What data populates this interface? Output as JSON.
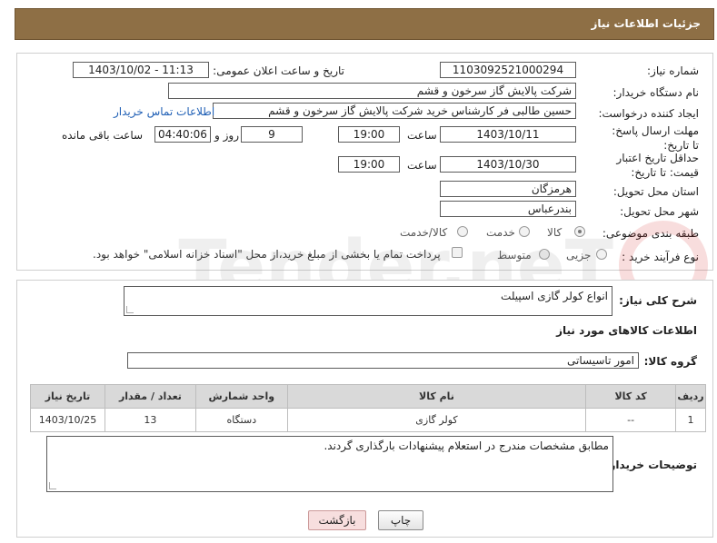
{
  "header": {
    "title": "جزئیات اطلاعات نیاز"
  },
  "form": {
    "need_number_label": "شماره نیاز:",
    "need_number": "1103092521000294",
    "announce_label": "تاریخ و ساعت اعلان عمومی:",
    "announce_value": "1403/10/02 - 11:13",
    "buyer_org_label": "نام دستگاه خریدار:",
    "buyer_org": "شرکت پالایش گاز سرخون و قشم",
    "requester_label": "ایجاد کننده درخواست:",
    "requester": "حسین طالبی فر کارشناس خرید شرکت پالایش گاز سرخون و قشم",
    "contact_link": "اطلاعات تماس خریدار",
    "reply_deadline_label": "مهلت ارسال پاسخ: تا تاریخ:",
    "reply_date": "1403/10/11",
    "time_label": "ساعت",
    "reply_time": "19:00",
    "days_value": "9",
    "days_label": "روز و",
    "remaining_time": "04:40:06",
    "remaining_label": "ساعت باقی مانده",
    "price_validity_label": "حداقل تاریخ اعتبار قیمت: تا تاریخ:",
    "price_date": "1403/10/30",
    "price_time": "19:00",
    "province_label": "استان محل تحویل:",
    "province": "هرمزگان",
    "city_label": "شهر محل تحویل:",
    "city": "بندرعباس",
    "category_label": "طبقه بندی موضوعی:",
    "category_options": [
      "کالا",
      "خدمت",
      "کالا/خدمت"
    ],
    "category_selected": "کالا",
    "process_label": "نوع فرآیند خرید :",
    "process_options": [
      "جزیی",
      "متوسط"
    ],
    "payment_note": "پرداخت تمام یا بخشی از مبلغ خرید،از محل \"اسناد خزانه اسلامی\" خواهد بود."
  },
  "details": {
    "general_desc_label": "شرح کلی نیاز:",
    "general_desc": "انواع کولر گازی اسپیلت",
    "goods_info_title": "اطلاعات کالاهای مورد نیاز",
    "goods_group_label": "گروه کالا:",
    "goods_group": "امور تاسیساتی",
    "table": {
      "headers": [
        "ردیف",
        "کد کالا",
        "نام کالا",
        "واحد شمارش",
        "تعداد / مقدار",
        "تاریخ نیاز"
      ],
      "rows": [
        [
          "1",
          "--",
          "کولر گازی",
          "دستگاه",
          "13",
          "1403/10/25"
        ]
      ]
    },
    "buyer_notes_label": "توضیحات خریدار:",
    "buyer_notes": "مطابق مشخصات مندرج در استعلام پیشنهادات بارگذاری گردند."
  },
  "buttons": {
    "print": "چاپ",
    "back": "بازگشت"
  },
  "colors": {
    "header_bg": "#8e6f45",
    "link": "#1f5fb5",
    "back_btn": "#f7dede"
  }
}
